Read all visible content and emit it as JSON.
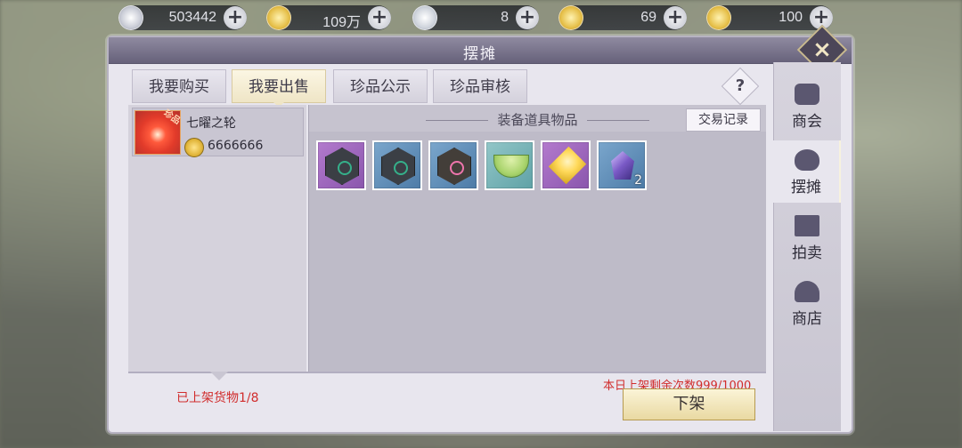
{
  "currencies": [
    {
      "icon": "silver-coin-icon",
      "value": "503442"
    },
    {
      "icon": "gold-coin-icon",
      "value": "109万"
    },
    {
      "icon": "silver-ingot-icon",
      "value": "8"
    },
    {
      "icon": "gold-ingot-locked-icon",
      "value": "69"
    },
    {
      "icon": "gold-ingot-icon",
      "value": "100"
    }
  ],
  "window": {
    "title": "摆摊"
  },
  "tabs": [
    {
      "label": "我要购买",
      "active": false
    },
    {
      "label": "我要出售",
      "active": true
    },
    {
      "label": "珍品公示",
      "active": false
    },
    {
      "label": "珍品审核",
      "active": false
    }
  ],
  "help_label": "?",
  "listing": {
    "tag": "珍品",
    "name": "七曜之轮",
    "price": "6666666"
  },
  "inventory": {
    "title": "装备道具物品",
    "trade_record_label": "交易记录",
    "items": [
      {
        "icon": "green-emblem-icon",
        "rarity": "purple",
        "count": ""
      },
      {
        "icon": "green-emblem-icon",
        "rarity": "blue",
        "count": ""
      },
      {
        "icon": "red-emblem-icon",
        "rarity": "blue",
        "count": ""
      },
      {
        "icon": "jade-bowl-icon",
        "rarity": "green",
        "count": ""
      },
      {
        "icon": "golden-gem-icon",
        "rarity": "purple",
        "count": ""
      },
      {
        "icon": "purple-crystal-icon",
        "rarity": "blue",
        "count": "2"
      }
    ]
  },
  "footer": {
    "listed_count": "已上架货物1/8",
    "remaining": "本日上架剩余次数999/1000",
    "delist_label": "下架"
  },
  "side_nav": [
    {
      "label": "商会",
      "icon": "guild-icon",
      "active": false
    },
    {
      "label": "摆摊",
      "icon": "stall-bag-icon",
      "active": true
    },
    {
      "label": "拍卖",
      "icon": "auction-icon",
      "active": false
    },
    {
      "label": "商店",
      "icon": "shop-icon",
      "active": false
    }
  ],
  "colors": {
    "accent_red": "#d12d2d",
    "gold_button": "#e9d9a2",
    "panel": "#e8e6ee"
  }
}
